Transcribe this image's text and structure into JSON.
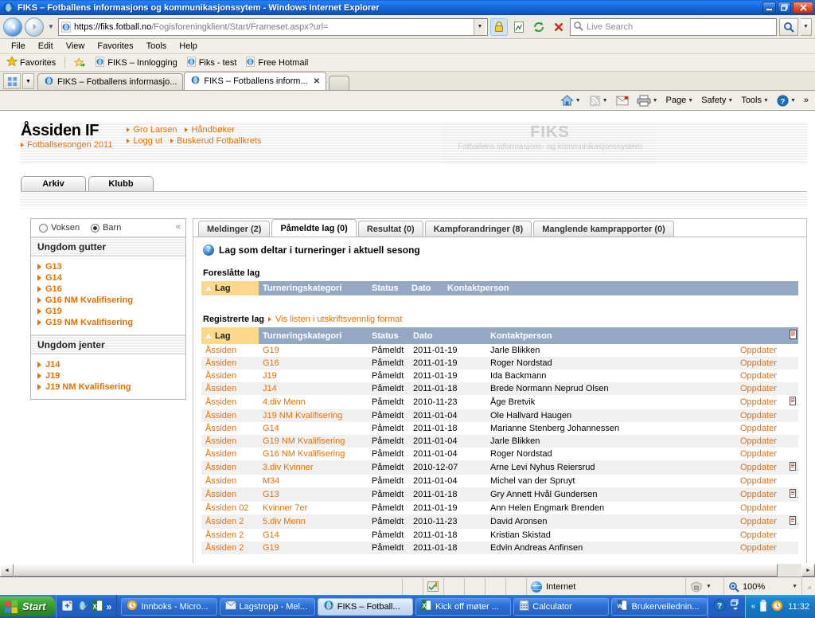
{
  "window": {
    "title": "FIKS – Fotballens informasjons og kommunikasjonssytem - Windows Internet Explorer",
    "minimize_label": "_",
    "restore_label": "❐",
    "close_label": "✕"
  },
  "address_bar": {
    "url_main": "https://fiks.fotball.no",
    "url_path": "/Fogisforeningklient/Start/Frameset.aspx?url=",
    "search_placeholder": "Live Search",
    "back_label": "◄",
    "forward_label": "►"
  },
  "menu": {
    "items": [
      "File",
      "Edit",
      "View",
      "Favorites",
      "Tools",
      "Help"
    ]
  },
  "favorites_bar": {
    "label": "Favorites",
    "items": [
      "FIKS – Innlogging",
      "Fiks - test",
      "Free Hotmail"
    ]
  },
  "browser_tabs": [
    {
      "label": "FIKS – Fotballens informasjo...",
      "active": false
    },
    {
      "label": "FIKS – Fotballens inform...",
      "active": true,
      "close": "✕"
    }
  ],
  "command_bar": {
    "items": [
      "Page",
      "Safety",
      "Tools"
    ],
    "overflow": "»"
  },
  "site_header": {
    "club_name": "Åssiden IF",
    "season": "Fotballsesongen 2011",
    "links": [
      "Gro Larsen",
      "Håndbøker",
      "Logg ut",
      "Buskerud Fotballkrets"
    ],
    "watermark_title": "FIKS",
    "watermark_subtitle": "Fotballens informasjons- og kommunikasjonssystem",
    "section_tabs": [
      "Arkiv",
      "Klubb"
    ]
  },
  "sidebar": {
    "radios": [
      {
        "label": "Voksen",
        "selected": false
      },
      {
        "label": "Barn",
        "selected": true
      }
    ],
    "collapse_icon": "«",
    "groups": [
      {
        "heading": "Ungdom gutter",
        "items": [
          "G13",
          "G14",
          "G16",
          "G16 NM Kvalifisering",
          "G19",
          "G19 NM Kvalifisering"
        ]
      },
      {
        "heading": "Ungdom jenter",
        "items": [
          "J14",
          "J19",
          "J19 NM Kvalifisering"
        ]
      }
    ]
  },
  "content": {
    "tabs": [
      {
        "label": "Meldinger (2)",
        "active": false
      },
      {
        "label": "Påmeldte lag (0)",
        "active": true
      },
      {
        "label": "Resultat (0)",
        "active": false
      },
      {
        "label": "Kampforandringer (8)",
        "active": false
      },
      {
        "label": "Manglende kamprapporter (0)",
        "active": false
      }
    ],
    "panel_title": "Lag som deltar i turneringer i aktuell sesong",
    "help_icon": "?",
    "proposed": {
      "label": "Foreslåtte lag",
      "columns": [
        "Lag",
        "Turneringskategori",
        "Status",
        "Dato",
        "Kontaktperson"
      ],
      "rows": []
    },
    "registered": {
      "label": "Registrerte lag",
      "print_link": "Vis listen i utskriftsvennlig format",
      "columns": [
        "Lag",
        "Turneringskategori",
        "Status",
        "Dato",
        "Kontaktperson"
      ],
      "update_label": "Oppdater",
      "rows": [
        {
          "lag": "Åssiden",
          "kategori": "G19",
          "status": "Påmeldt",
          "dato": "2011-01-19",
          "kontakt": "Jarle Blikken",
          "doc": false
        },
        {
          "lag": "Åssiden",
          "kategori": "G16",
          "status": "Påmeldt",
          "dato": "2011-01-19",
          "kontakt": "Roger Nordstad",
          "doc": false
        },
        {
          "lag": "Åssiden",
          "kategori": "J19",
          "status": "Påmeldt",
          "dato": "2011-01-19",
          "kontakt": "Ida Backmann",
          "doc": false
        },
        {
          "lag": "Åssiden",
          "kategori": "J14",
          "status": "Påmeldt",
          "dato": "2011-01-18",
          "kontakt": "Brede Normann Neprud Olsen",
          "doc": false
        },
        {
          "lag": "Åssiden",
          "kategori": "4.div Menn",
          "status": "Påmeldt",
          "dato": "2010-11-23",
          "kontakt": "Åge Bretvik",
          "doc": true
        },
        {
          "lag": "Åssiden",
          "kategori": "J19 NM Kvalifisering",
          "status": "Påmeldt",
          "dato": "2011-01-04",
          "kontakt": "Ole Hallvard Haugen",
          "doc": false
        },
        {
          "lag": "Åssiden",
          "kategori": "G14",
          "status": "Påmeldt",
          "dato": "2011-01-18",
          "kontakt": "Marianne Stenberg Johannessen",
          "doc": false
        },
        {
          "lag": "Åssiden",
          "kategori": "G19 NM Kvalifisering",
          "status": "Påmeldt",
          "dato": "2011-01-04",
          "kontakt": "Jarle Blikken",
          "doc": false
        },
        {
          "lag": "Åssiden",
          "kategori": "G16 NM Kvalifisering",
          "status": "Påmeldt",
          "dato": "2011-01-04",
          "kontakt": "Roger Nordstad",
          "doc": false
        },
        {
          "lag": "Åssiden",
          "kategori": "3.div Kvinner",
          "status": "Påmeldt",
          "dato": "2010-12-07",
          "kontakt": "Arne Levi Nyhus Reiersrud",
          "doc": true
        },
        {
          "lag": "Åssiden",
          "kategori": "M34",
          "status": "Påmeldt",
          "dato": "2011-01-04",
          "kontakt": "Michel van der Spruyt",
          "doc": false
        },
        {
          "lag": "Åssiden",
          "kategori": "G13",
          "status": "Påmeldt",
          "dato": "2011-01-18",
          "kontakt": "Gry Annett Hvål Gundersen",
          "doc": true
        },
        {
          "lag": "Åssiden 02",
          "kategori": "Kvinner 7er",
          "status": "Påmeldt",
          "dato": "2011-01-19",
          "kontakt": "Ann Helen Engmark Brenden",
          "doc": false
        },
        {
          "lag": "Åssiden 2",
          "kategori": "5.div Menn",
          "status": "Påmeldt",
          "dato": "2010-11-23",
          "kontakt": "David Aronsen",
          "doc": true
        },
        {
          "lag": "Åssiden 2",
          "kategori": "G14",
          "status": "Påmeldt",
          "dato": "2011-01-18",
          "kontakt": "Kristian Skistad",
          "doc": false
        },
        {
          "lag": "Åssiden 2",
          "kategori": "G19",
          "status": "Påmeldt",
          "dato": "2011-01-18",
          "kontakt": "Edvin Andreas Anfinsen",
          "doc": false
        }
      ]
    }
  },
  "status_bar": {
    "zone": "Internet",
    "zoom": "100%"
  },
  "taskbar": {
    "start_label": "Start",
    "quicklaunch_overflow": "»",
    "tasks": [
      {
        "label": "Innboks - Micro...",
        "active": false,
        "icon": "outlook-icon"
      },
      {
        "label": "Lagstropp - Mel...",
        "active": false,
        "icon": "mail-icon"
      },
      {
        "label": "FIKS – Fotball...",
        "active": true,
        "icon": "ie-icon"
      },
      {
        "label": "Kick off møter ...",
        "active": false,
        "icon": "excel-icon"
      },
      {
        "label": "Calculator",
        "active": false,
        "icon": "calculator-icon"
      },
      {
        "label": "Brukerveilednin...",
        "active": false,
        "icon": "word-icon"
      }
    ],
    "tray_chevron": "«",
    "clock": "11:32"
  },
  "colors": {
    "accent_orange": "#e87000",
    "header_blue": "#94a8c4",
    "sort_yellow": "#fbd88b",
    "title_blue": "#1a6cdf"
  }
}
